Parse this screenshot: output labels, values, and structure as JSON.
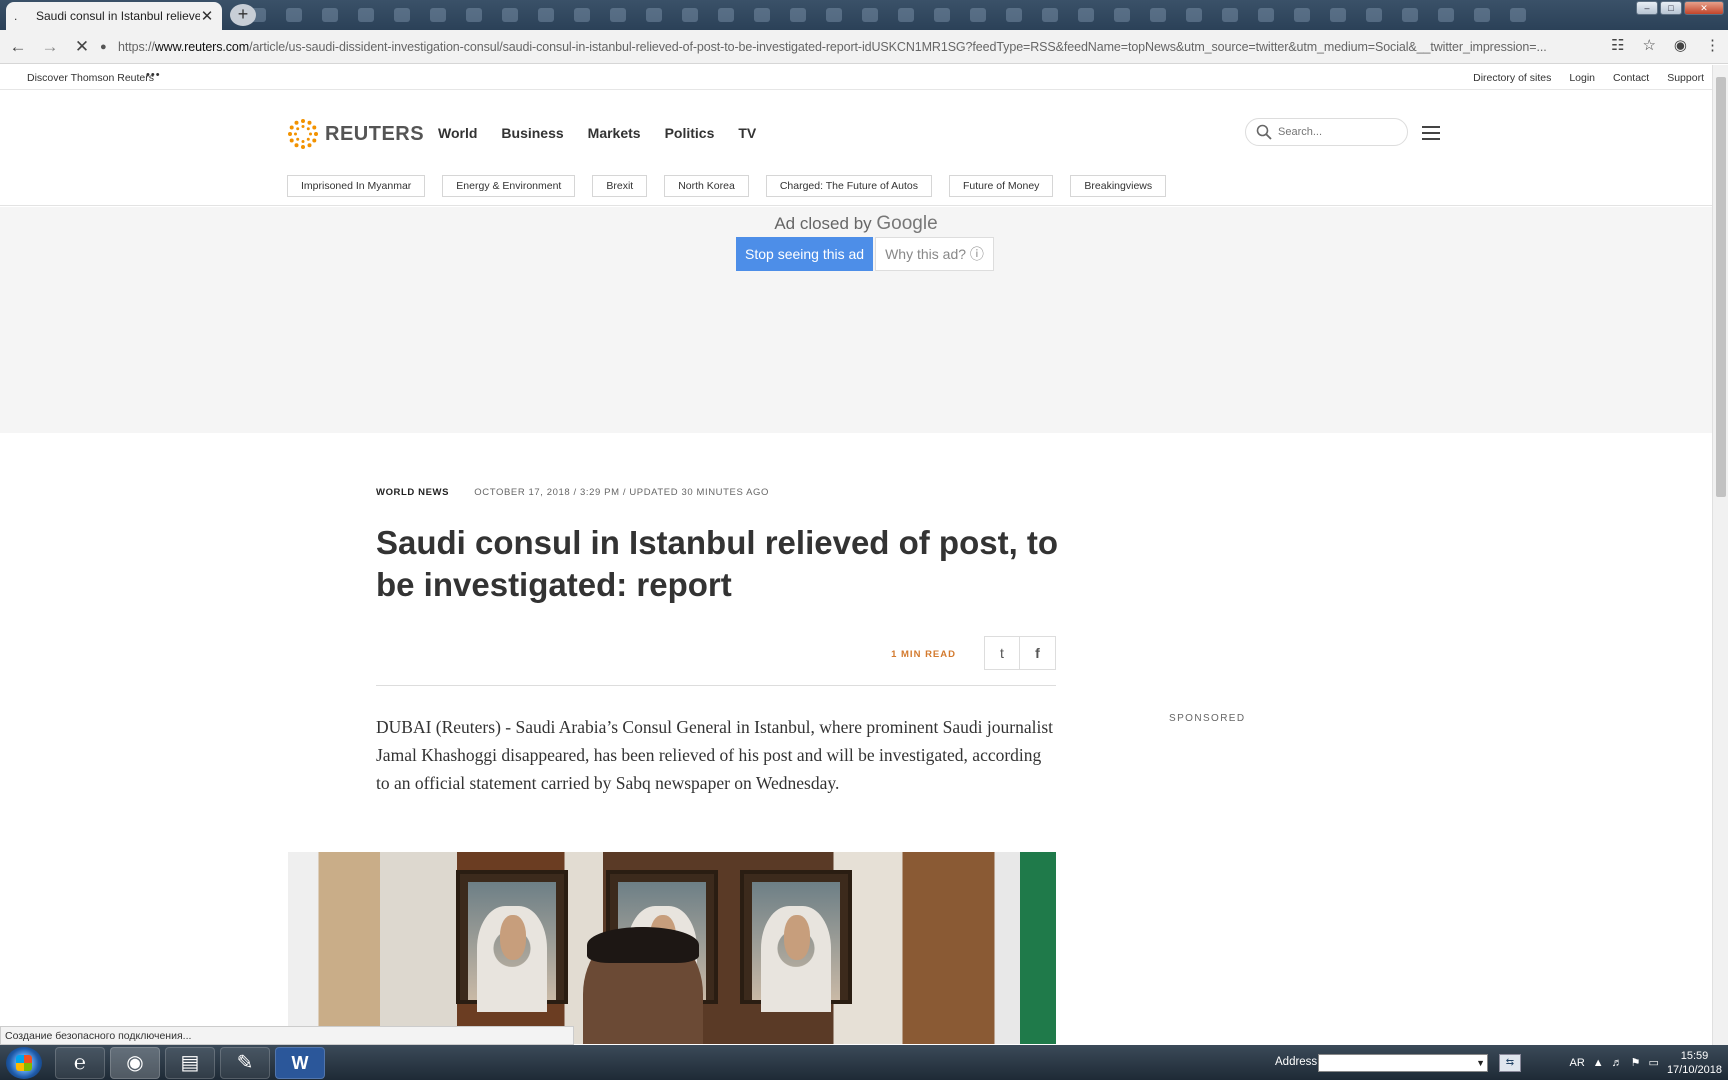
{
  "browser": {
    "tab_title": "Saudi consul in Istanbul relieved of post, to be investigated: report",
    "tab_dot": ".",
    "url_scheme": "https://",
    "url_host": "www.reuters.com",
    "url_path": "/article/us-saudi-dissident-investigation-consul/saudi-consul-in-istanbul-relieved-of-post-to-be-investigated-report-idUSKCN1MR1SG?feedType=RSS&feedName=topNews&utm_source=twitter&utm_medium=Social&__twitter_impression=..."
  },
  "util": {
    "discover": "Discover Thomson Reuters",
    "more": "•••",
    "links": [
      "Directory of sites",
      "Login",
      "Contact",
      "Support"
    ]
  },
  "masthead": {
    "logo_text": "REUTERS",
    "nav": [
      "World",
      "Business",
      "Markets",
      "Politics",
      "TV"
    ],
    "search_placeholder": "Search...",
    "pills": [
      "Imprisoned In Myanmar",
      "Energy & Environment",
      "Brexit",
      "North Korea",
      "Charged: The Future of Autos",
      "Future of Money",
      "Breakingviews"
    ]
  },
  "ad": {
    "closed_text": "Ad closed by",
    "brand": "Google",
    "stop_label": "Stop seeing this ad",
    "why_label": "Why this ad? ⓘ"
  },
  "article": {
    "section": "WORLD NEWS",
    "dateline": "OCTOBER 17, 2018 / 3:29 PM / UPDATED 30 MINUTES AGO",
    "headline": "Saudi consul in Istanbul relieved of post, to be investigated: report",
    "read_time": "1 MIN READ",
    "body": "DUBAI (Reuters) - Saudi Arabia’s Consul General in Istanbul, where prominent Saudi journalist Jamal Khashoggi disappeared, has been relieved of his post and will be investigated, according to an official statement carried by Sabq newspaper on Wednesday."
  },
  "sidebar": {
    "sponsored": "SPONSORED"
  },
  "status_text": "Создание безопасного подключения...",
  "taskbar": {
    "address_label": "Address",
    "lang": "AR",
    "time": "15:59",
    "date": "17/10/2018"
  },
  "icons": {
    "back": "←",
    "forward": "→",
    "reload": "✕",
    "lock": "🔒",
    "translate": "☷",
    "star": "☆",
    "account": "◉",
    "menu": "⋮",
    "close_tab": "✕",
    "new_tab": "+",
    "twitter": "t",
    "facebook": "f",
    "search": "⚲"
  },
  "colors": {
    "reuters_orange": "#f29200",
    "ad_button_blue": "#4d8ee8",
    "read_time_orange": "#d37a2e"
  }
}
